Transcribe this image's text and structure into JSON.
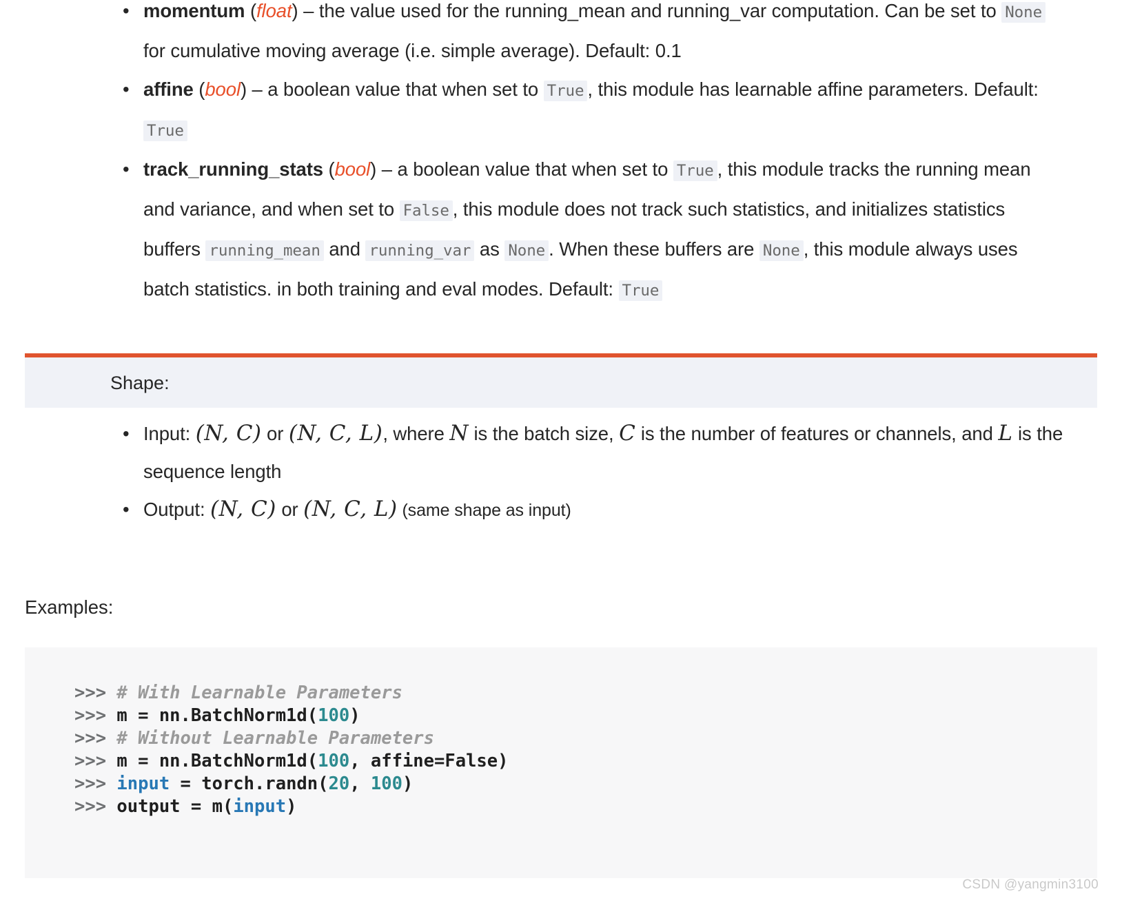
{
  "params": [
    {
      "name": "momentum",
      "type": "float",
      "desc_1": ") – the value used for the running_mean and running_var computation. Can be set to ",
      "code_1": "None",
      "desc_2": " for cumulative moving average (i.e. simple average). Default: 0.1"
    },
    {
      "name": "affine",
      "type": "bool",
      "desc_1": ") – a boolean value that when set to ",
      "code_1": "True",
      "desc_2": ", this module has learnable affine parameters. Default: ",
      "code_2": "True"
    },
    {
      "name": "track_running_stats",
      "type": "bool",
      "desc_1": ") – a boolean value that when set to ",
      "code_1": "True",
      "desc_2": ", this module tracks the running mean and variance, and when set to ",
      "code_2": "False",
      "desc_3": ", this module does not track such statistics, and initializes statistics buffers ",
      "code_3": "running_mean",
      "desc_4": " and ",
      "code_4": "running_var",
      "desc_5": " as ",
      "code_5": "None",
      "desc_6": ". When these buffers are ",
      "code_6": "None",
      "desc_7": ", this module always uses batch statistics. in both training and eval modes. Default: ",
      "code_7": "True"
    }
  ],
  "shape": {
    "title": "Shape:",
    "accent_color": "#e0542e",
    "header_bg": "#f0f2f7",
    "input": {
      "label": "Input: ",
      "math_a": "(N, C)",
      "or": " or ",
      "math_b": "(N, C, L)",
      "tail_1": ", where ",
      "math_c": "N",
      "tail_2": " is the batch size, ",
      "math_d": "C",
      "tail_3": " is the number of features or channels, and ",
      "math_e": "L",
      "tail_4": " is the sequence length"
    },
    "output": {
      "label": "Output: ",
      "math_a": "(N, C)",
      "or": " or ",
      "math_b": "(N, C, L)",
      "tail": " (same shape as input)"
    }
  },
  "examples": {
    "label": "Examples:",
    "code_lines": [
      {
        "prompt": ">>> ",
        "parts": [
          {
            "text": "# With Learnable Parameters",
            "kind": "comment"
          }
        ]
      },
      {
        "prompt": ">>> ",
        "parts": [
          {
            "text": "m = nn.BatchNorm1d(",
            "kind": "plain"
          },
          {
            "text": "100",
            "kind": "number"
          },
          {
            "text": ")",
            "kind": "plain"
          }
        ]
      },
      {
        "prompt": ">>> ",
        "parts": [
          {
            "text": "# Without Learnable Parameters",
            "kind": "comment"
          }
        ]
      },
      {
        "prompt": ">>> ",
        "parts": [
          {
            "text": "m = nn.BatchNorm1d(",
            "kind": "plain"
          },
          {
            "text": "100",
            "kind": "number"
          },
          {
            "text": ", affine=False)",
            "kind": "plain"
          }
        ]
      },
      {
        "prompt": ">>> ",
        "parts": [
          {
            "text": "input",
            "kind": "builtin"
          },
          {
            "text": " = torch.randn(",
            "kind": "plain"
          },
          {
            "text": "20",
            "kind": "number"
          },
          {
            "text": ", ",
            "kind": "plain"
          },
          {
            "text": "100",
            "kind": "number"
          },
          {
            "text": ")",
            "kind": "plain"
          }
        ]
      },
      {
        "prompt": ">>> ",
        "parts": [
          {
            "text": "output = m(",
            "kind": "plain"
          },
          {
            "text": "input",
            "kind": "builtin"
          },
          {
            "text": ")",
            "kind": "plain"
          }
        ]
      }
    ]
  },
  "watermark": "CSDN @yangmin3100",
  "bullet_glyph": "•"
}
